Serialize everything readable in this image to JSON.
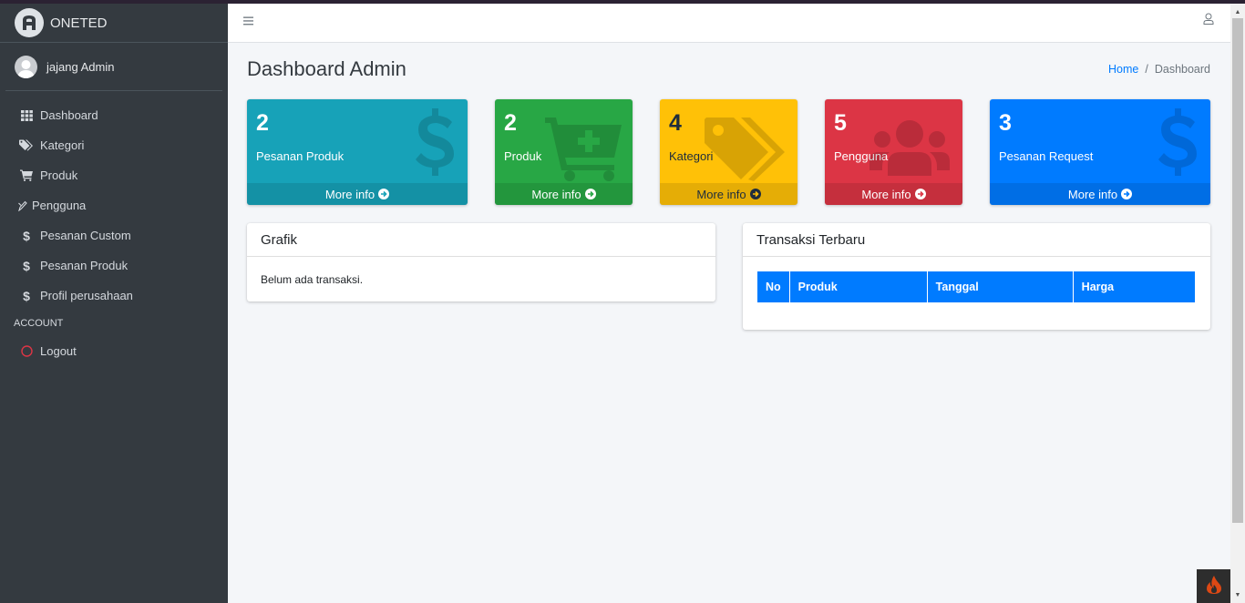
{
  "brand": {
    "name": "ONETED"
  },
  "user": {
    "name": "jajang Admin"
  },
  "sidebar": {
    "items": [
      {
        "label": "Dashboard",
        "icon": "th-icon"
      },
      {
        "label": "Kategori",
        "icon": "tags-icon"
      },
      {
        "label": "Produk",
        "icon": "cart-icon"
      },
      {
        "label": "Pengguna",
        "icon": "pencil-icon"
      },
      {
        "label": "Pesanan Custom",
        "icon": "dollar-icon"
      },
      {
        "label": "Pesanan Produk",
        "icon": "dollar-icon"
      },
      {
        "label": "Profil perusahaan",
        "icon": "dollar-icon"
      }
    ],
    "header": "ACCOUNT",
    "logout": {
      "label": "Logout",
      "icon": "circle-icon",
      "color": "#dc3545"
    }
  },
  "page": {
    "title": "Dashboard Admin"
  },
  "breadcrumb": {
    "home": "Home",
    "separator": "/",
    "current": "Dashboard"
  },
  "stats": [
    {
      "count": "2",
      "label": "Pesanan Produk",
      "more": "More info",
      "color": "#17a2b8",
      "icon": "dollar-icon"
    },
    {
      "count": "2",
      "label": "Produk",
      "more": "More info",
      "color": "#28a745",
      "icon": "cart-plus-icon"
    },
    {
      "count": "4",
      "label": "Kategori",
      "more": "More info",
      "color": "#ffc107",
      "icon": "tags-icon"
    },
    {
      "count": "5",
      "label": "Pengguna",
      "more": "More info",
      "color": "#dc3545",
      "icon": "users-icon"
    },
    {
      "count": "3",
      "label": "Pesanan Request",
      "more": "More info",
      "color": "#007bff",
      "icon": "dollar-icon"
    }
  ],
  "grafik": {
    "title": "Grafik",
    "empty_text": "Belum ada transaksi."
  },
  "transaksi": {
    "title": "Transaksi Terbaru",
    "columns": [
      "No",
      "Produk",
      "Tanggal",
      "Harga"
    ],
    "rows": []
  }
}
